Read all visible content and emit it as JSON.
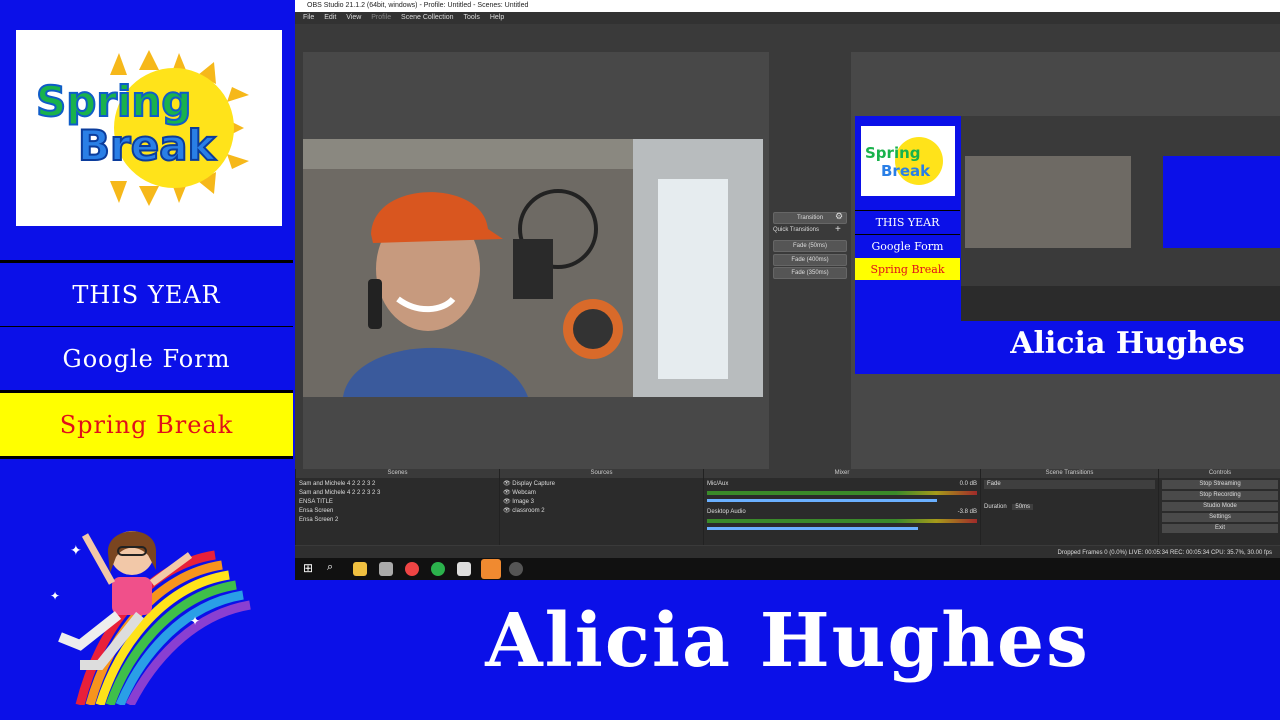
{
  "overlay": {
    "logo_line1": "Spring",
    "logo_line2": "Break",
    "buttons": [
      "THIS YEAR",
      "Google Form",
      "Spring Break"
    ],
    "name": "Alicia Hughes"
  },
  "obs": {
    "title": "OBS Studio 21.1.2 (64bit, windows) - Profile: Untitled - Scenes: Untitled",
    "menu": [
      "File",
      "Edit",
      "View",
      "Profile",
      "Scene Collection",
      "Tools",
      "Help"
    ],
    "transition_panel": {
      "transition_label": "Transition",
      "quick_label": "Quick Transitions",
      "items": [
        "Fade (50ms)",
        "Fade (400ms)",
        "Fade (350ms)"
      ]
    },
    "docks": {
      "scenes_title": "Scenes",
      "scenes": [
        "Sam and Michele 4 2 2 2 3 2",
        "Sam and Michele 4 2 2 2 3 2 3",
        "ENSA TITLE",
        "Ensa Screen",
        "Ensa Screen 2"
      ],
      "sources_title": "Sources",
      "sources": [
        "Display Capture",
        "Webcam",
        "Image 3",
        "classroom 2"
      ],
      "mixer_title": "Mixer",
      "mixer_tracks": [
        {
          "name": "Mic/Aux",
          "db": "0.0 dB"
        },
        {
          "name": "Desktop Audio",
          "db": "-3.8 dB"
        }
      ],
      "transitions_title": "Scene Transitions",
      "transition_value": "Fade",
      "duration_label": "Duration",
      "duration_value": "50ms",
      "controls_title": "Controls",
      "controls": [
        "Stop Streaming",
        "Stop Recording",
        "Studio Mode",
        "Settings",
        "Exit"
      ]
    },
    "status": "Dropped Frames 0 (0.0%)    LIVE: 00:05:34    REC: 00:05:34    CPU: 35.7%, 30.00 fps"
  },
  "colors": {
    "blue": "#0b10e8",
    "yellow": "#ffff00",
    "red": "#e0101a"
  }
}
